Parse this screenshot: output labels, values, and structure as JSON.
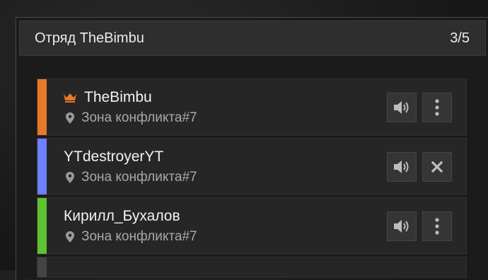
{
  "squad": {
    "title": "Отряд TheBimbu",
    "count": "3/5"
  },
  "members": [
    {
      "name": "TheBimbu",
      "location": "Зона конфликта#7",
      "leader": true,
      "color": "#e8782a",
      "action_icon": "more-vertical-icon"
    },
    {
      "name": "YTdestroyerYT",
      "location": "Зона конфликта#7",
      "leader": false,
      "color": "#6f7fff",
      "action_icon": "close-icon"
    },
    {
      "name": "Кирилл_Бухалов",
      "location": "Зона конфликта#7",
      "leader": false,
      "color": "#5ec232",
      "action_icon": "more-vertical-icon"
    }
  ],
  "colors": {
    "leader_crown": "#e8782a",
    "empty_slot": "#444444"
  }
}
